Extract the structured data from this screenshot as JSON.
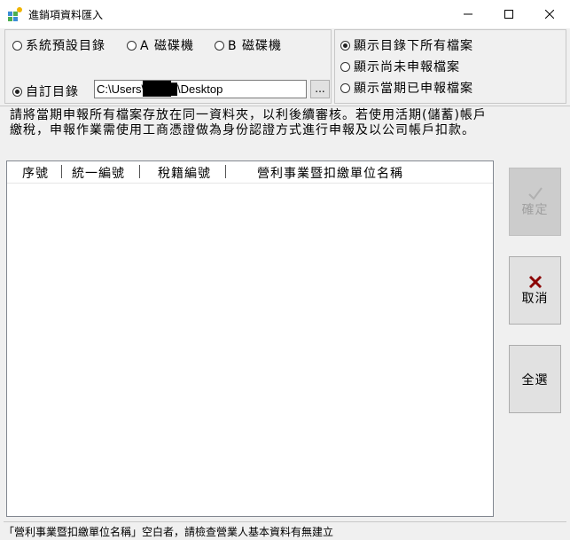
{
  "window": {
    "title": "進銷項資料匯入",
    "icon": "app-grid-icon",
    "controls": [
      "minimize-icon",
      "maximize-icon",
      "close-icon"
    ]
  },
  "source_options": {
    "default_dir": "系統預設目錄",
    "drive_a": "A 磁碟機",
    "drive_b": "B 磁碟機",
    "custom_dir": "自訂目錄",
    "selected": "custom_dir"
  },
  "path": {
    "value": "C:\\Users\\████\\Desktop",
    "browse_label": "..."
  },
  "file_filter": {
    "all_files": "顯示目錄下所有檔案",
    "not_filed": "顯示尚未申報檔案",
    "filed_current": "顯示當期已申報檔案",
    "selected": "all_files"
  },
  "notice": {
    "line1": "請將當期申報所有檔案存放在同一資料夾，以利後續審核。若使用活期(儲蓄)帳戶",
    "line2": "繳稅，申報作業需使用工商憑證做為身份認證方式進行申報及以公司帳戶扣款。"
  },
  "table": {
    "columns": [
      "序號",
      "統一編號",
      "稅籍編號",
      "營利事業暨扣繳單位名稱"
    ],
    "rows": []
  },
  "buttons": {
    "confirm": "確定",
    "cancel": "取消",
    "select_all": "全選"
  },
  "status_text": "「營利事業暨扣繳單位名稱」空白者，請檢查營業人基本資料有無建立",
  "colors": {
    "cancel_icon": "#8b0000",
    "disabled_text": "#a0a0a0"
  }
}
